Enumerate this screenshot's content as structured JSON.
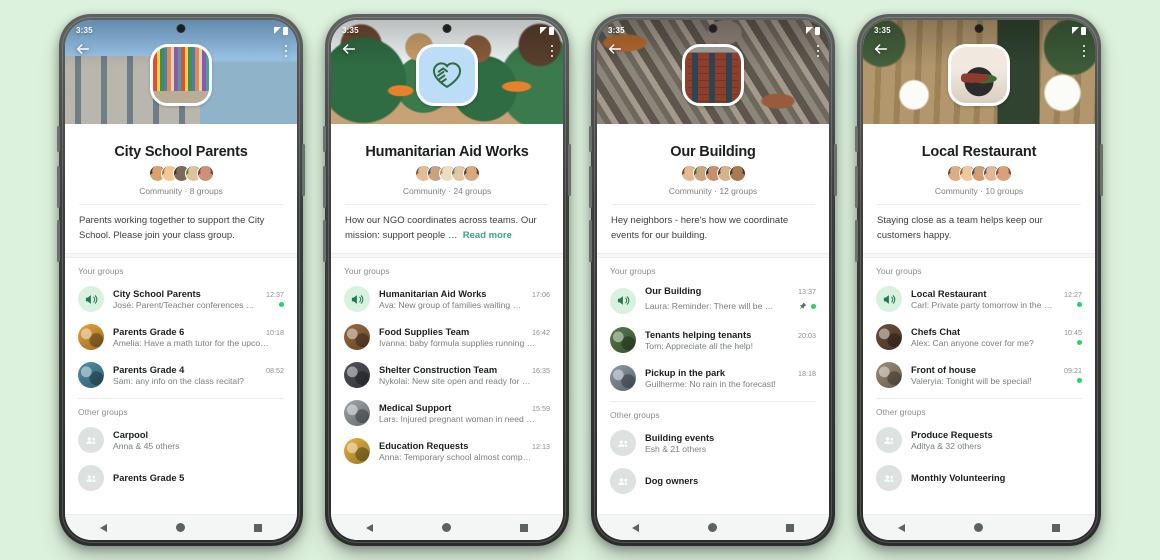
{
  "page": {
    "background_color": "#ddf2dd",
    "accent_green": "#25d366",
    "link_green": "#3aa680"
  },
  "status_bar": {
    "time": "3:35"
  },
  "nav_bar": {
    "back": "back",
    "home": "home",
    "recents": "recents"
  },
  "labels": {
    "your_groups": "Your groups",
    "other_groups": "Other groups",
    "read_more": "Read more"
  },
  "phones": [
    {
      "id": "city-school-parents",
      "title": "City School Parents",
      "subtitle": "Community · 8 groups",
      "description": "Parents working together to support the City School. Please join your class group.",
      "has_read_more": false,
      "cover_class": "cover-school",
      "avatar_class": "av-books",
      "avatar_icon": "books-icon",
      "your_groups": [
        {
          "name": "City School Parents",
          "time": "12:37",
          "message": "José: Parent/Teacher conferences …",
          "avatar": "megaphone-icon",
          "unread": true,
          "pinned": false
        },
        {
          "name": "Parents Grade 6",
          "time": "10:18",
          "message": "Amelia: Have a math tutor for the upco…",
          "avatar": "group-photo",
          "unread": false,
          "pinned": false,
          "av_color": "#e8a33d"
        },
        {
          "name": "Parents Grade 4",
          "time": "08:52",
          "message": "Sam: any info on the class recital?",
          "avatar": "group-photo",
          "unread": false,
          "pinned": false,
          "av_color": "#4f8fa8"
        }
      ],
      "other_groups": [
        {
          "name": "Carpool",
          "message": "Anna & 45 others"
        },
        {
          "name": "Parents Grade 5",
          "message": ""
        }
      ]
    },
    {
      "id": "humanitarian-aid-works",
      "title": "Humanitarian Aid Works",
      "subtitle": "Community · 24 groups",
      "description": "How our NGO coordinates across teams. Our mission: support people …",
      "has_read_more": true,
      "cover_class": "cover-ngo",
      "avatar_class": "av-heart",
      "avatar_icon": "heart-hands-icon",
      "your_groups": [
        {
          "name": "Humanitarian Aid Works",
          "time": "17:06",
          "message": "Ava: New group of families waiting …",
          "avatar": "megaphone-icon",
          "unread": false,
          "pinned": false
        },
        {
          "name": "Food Supplies Team",
          "time": "16:42",
          "message": "Ivanna: baby formula supplies running …",
          "avatar": "group-photo",
          "unread": false,
          "pinned": false,
          "av_color": "#9a6b3f"
        },
        {
          "name": "Shelter Construction Team",
          "time": "16:35",
          "message": "Nykolai: New site open and ready for …",
          "avatar": "group-photo",
          "unread": false,
          "pinned": false,
          "av_color": "#50525a"
        },
        {
          "name": "Medical Support",
          "time": "15:59",
          "message": "Lars: Injured pregnant woman in need …",
          "avatar": "group-photo",
          "unread": false,
          "pinned": false,
          "av_color": "#9fa6a9"
        },
        {
          "name": "Education Requests",
          "time": "12:13",
          "message": "Anna: Temporary school almost comp…",
          "avatar": "group-photo",
          "unread": false,
          "pinned": false,
          "av_color": "#e8b53d"
        }
      ],
      "other_groups": []
    },
    {
      "id": "our-building",
      "title": "Our Building",
      "subtitle": "Community · 12 groups",
      "description": "Hey neighbors - here's how we coordinate events for our building.",
      "has_read_more": false,
      "cover_class": "cover-city",
      "avatar_class": "av-bldg",
      "avatar_icon": "building-icon",
      "your_groups": [
        {
          "name": "Our Building",
          "time": "13:37",
          "message": "Laura: Reminder:  There will be …",
          "avatar": "megaphone-icon",
          "unread": true,
          "pinned": true
        },
        {
          "name": "Tenants helping tenants",
          "time": "20:03",
          "message": "Tom: Appreciate all the help!",
          "avatar": "group-photo",
          "unread": false,
          "pinned": false,
          "av_color": "#567a4a"
        },
        {
          "name": "Pickup in the park",
          "time": "18:18",
          "message": "Guilherme: No rain in the forecast!",
          "avatar": "group-photo",
          "unread": false,
          "pinned": false,
          "av_color": "#8c9aa3"
        }
      ],
      "other_groups": [
        {
          "name": "Building events",
          "message": "Esh & 21 others"
        },
        {
          "name": "Dog owners",
          "message": ""
        }
      ]
    },
    {
      "id": "local-restaurant",
      "title": "Local Restaurant",
      "subtitle": "Community · 10 groups",
      "description": "Staying close as a team helps keep our customers happy.",
      "has_read_more": false,
      "cover_class": "cover-rest",
      "avatar_class": "av-food",
      "avatar_icon": "plated-food-icon",
      "your_groups": [
        {
          "name": "Local Restaurant",
          "time": "12:27",
          "message": "Carl: Private party tomorrow in the …",
          "avatar": "megaphone-icon",
          "unread": true,
          "pinned": false
        },
        {
          "name": "Chefs Chat",
          "time": "10:45",
          "message": "Alex: Can anyone cover for me?",
          "avatar": "group-photo",
          "unread": true,
          "pinned": false,
          "av_color": "#6b4f3a"
        },
        {
          "name": "Front of house",
          "time": "09:21",
          "message": "Valeryia: Tonight will be special!",
          "avatar": "group-photo",
          "unread": true,
          "pinned": false,
          "av_color": "#a08d78"
        }
      ],
      "other_groups": [
        {
          "name": "Produce Requests",
          "message": "Aditya & 32 others"
        },
        {
          "name": "Monthly Volunteering",
          "message": ""
        }
      ]
    }
  ]
}
